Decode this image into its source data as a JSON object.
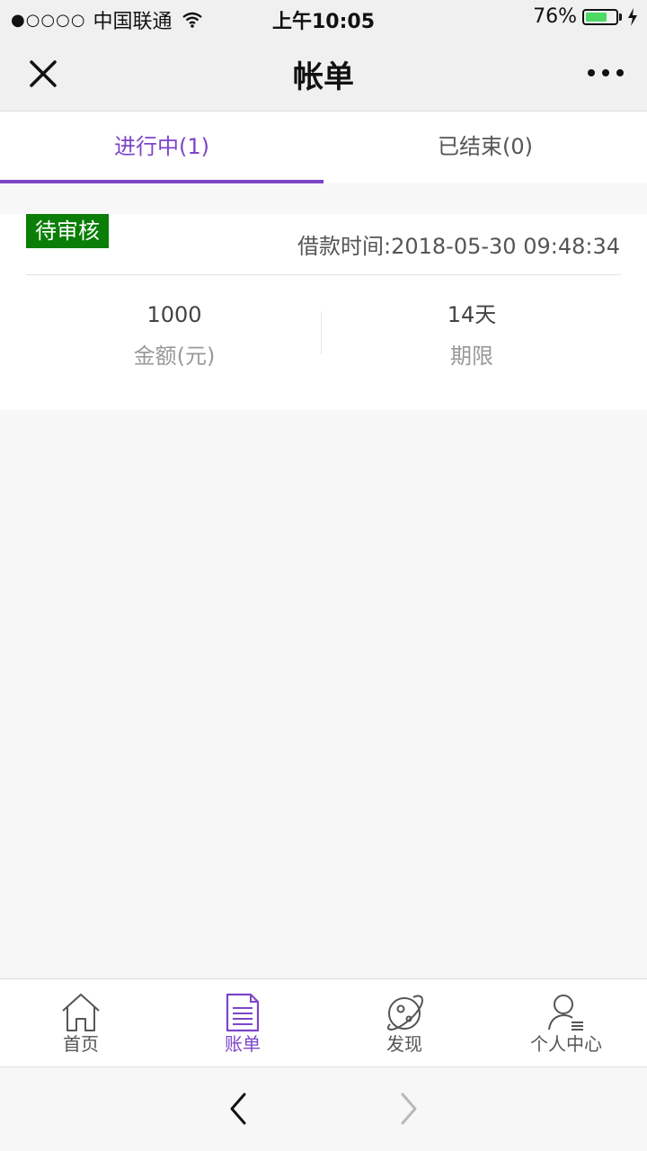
{
  "status_bar": {
    "signal": "●○○○○",
    "carrier": "中国联通",
    "time": "上午10:05",
    "battery_percent": "76%",
    "battery_level": 0.76,
    "battery_color": "#4cd964"
  },
  "nav": {
    "title": "帐单",
    "close_icon": "close-icon",
    "more_icon": "more-icon"
  },
  "tabs": [
    {
      "label": "进行中(1)",
      "active": true
    },
    {
      "label": "已结束(0)",
      "active": false
    }
  ],
  "accent_color": "#7d45c8",
  "bill": {
    "status": "待审核",
    "status_color": "#0a7e07",
    "loan_time": "借款时间:2018-05-30 09:48:34",
    "amount_value": "1000",
    "amount_label": "金额(元)",
    "term_value": "14天",
    "term_label": "期限"
  },
  "bottom_nav": [
    {
      "label": "首页",
      "icon": "home-icon",
      "active": false
    },
    {
      "label": "账单",
      "icon": "bill-icon",
      "active": true
    },
    {
      "label": "发现",
      "icon": "planet-icon",
      "active": false
    },
    {
      "label": "个人中心",
      "icon": "user-icon",
      "active": false
    }
  ],
  "browser": {
    "back_icon": "chevron-left-icon",
    "forward_icon": "chevron-right-icon"
  }
}
